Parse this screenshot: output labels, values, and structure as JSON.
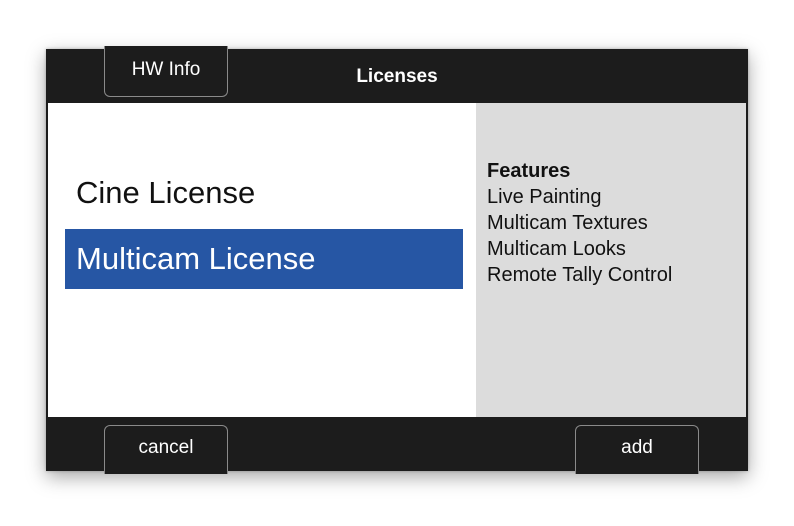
{
  "header": {
    "title": "Licenses",
    "hw_info_label": "HW Info"
  },
  "licenses": {
    "items": [
      {
        "label": "Cine License",
        "selected": false
      },
      {
        "label": "Multicam License",
        "selected": true
      }
    ]
  },
  "features": {
    "heading": "Features",
    "items": [
      "Live Painting",
      "Multicam Textures",
      "Multicam Looks",
      "Remote Tally Control"
    ]
  },
  "footer": {
    "cancel_label": "cancel",
    "add_label": "add"
  },
  "colors": {
    "selection": "#2656a4",
    "bar_background": "#1c1c1c",
    "feature_panel": "#dcdcdc"
  }
}
